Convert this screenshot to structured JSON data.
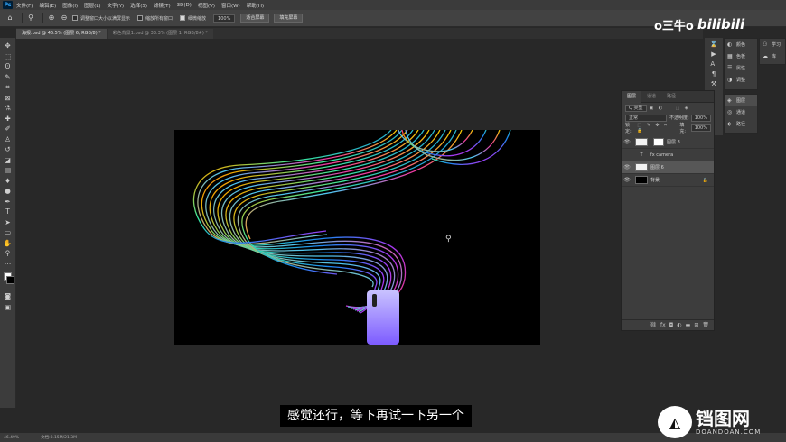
{
  "menubar": {
    "logo": "Ps",
    "items": [
      "文件(F)",
      "编辑(E)",
      "图像(I)",
      "图层(L)",
      "文字(Y)",
      "选择(S)",
      "滤镜(T)",
      "3D(D)",
      "视图(V)",
      "窗口(W)",
      "帮助(H)"
    ]
  },
  "options": {
    "resize_windows": "调整窗口大小以满屏显示",
    "zoom_all": "缩放所有窗口",
    "scrubby_zoom": "细微缩放",
    "zoom_value": "100%",
    "fit_screen": "适合屏幕",
    "fill_screen": "填充屏幕"
  },
  "tabs": [
    {
      "label": "海报.psd @ 46.5% (图层 6, RGB/8) *"
    },
    {
      "label": "彩色背景1.psd @ 33.3% (图层 1, RGB/8#) *"
    }
  ],
  "tools": [
    "move-icon",
    "marquee-icon",
    "lasso-icon",
    "quick-select-icon",
    "crop-icon",
    "frame-icon",
    "eyedropper-icon",
    "healing-icon",
    "brush-icon",
    "stamp-icon",
    "history-brush-icon",
    "eraser-icon",
    "gradient-icon",
    "blur-icon",
    "dodge-icon",
    "pen-icon",
    "type-icon",
    "path-select-icon",
    "rectangle-icon",
    "hand-icon",
    "zoom-icon",
    "more-icon"
  ],
  "layers_panel": {
    "tabs": [
      "图层",
      "通道",
      "路径"
    ],
    "kind_filter": "Q 类型",
    "blend_mode": "正常",
    "opacity_label": "不透明度:",
    "opacity_value": "100%",
    "lock_label": "锁定:",
    "fill_label": "填充:",
    "fill_value": "100%",
    "layers": [
      {
        "name": "图层 3",
        "thumb": "white",
        "has_mask": true,
        "visible": true,
        "selected": false
      },
      {
        "name": "fx camera",
        "thumb": "type",
        "has_mask": false,
        "visible": false,
        "selected": false
      },
      {
        "name": "图层 6",
        "thumb": "white",
        "has_mask": false,
        "visible": true,
        "selected": true
      },
      {
        "name": "背景",
        "thumb": "black",
        "has_mask": false,
        "visible": true,
        "selected": false
      }
    ]
  },
  "right_dock": {
    "col_a": [
      "颜色",
      "色板",
      "属性",
      "调整"
    ],
    "col_b": [
      "图层",
      "通道",
      "路径"
    ],
    "col_c": [
      "学习",
      "库"
    ]
  },
  "status": {
    "zoom": "46.49%",
    "doc": "文档:3.15M/21.3M"
  },
  "watermark_top": {
    "user": "o三牛o",
    "brand": "bilibili"
  },
  "subtitle": "感觉还行，等下再试一下另一个",
  "watermark_bottom": {
    "cn": "铛图网",
    "en": "DOANDOAN.COM"
  }
}
